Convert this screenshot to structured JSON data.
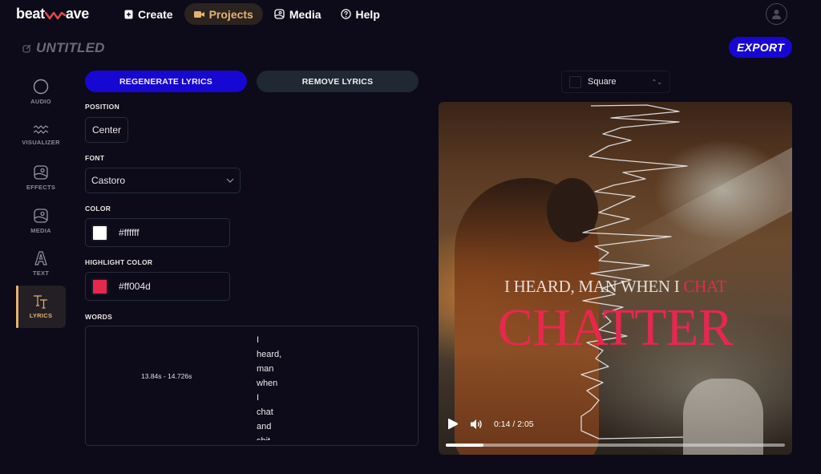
{
  "app": {
    "logo_left": "beat",
    "logo_right": "ave"
  },
  "nav": [
    {
      "label": "Create",
      "icon": "plus-file-icon",
      "active": false
    },
    {
      "label": "Projects",
      "icon": "video-camera-icon",
      "active": true
    },
    {
      "label": "Media",
      "icon": "image-icon",
      "active": false
    },
    {
      "label": "Help",
      "icon": "question-circle-icon",
      "active": false
    }
  ],
  "project": {
    "title": "UNTITLED",
    "export_label": "EXPORT"
  },
  "sidebar": [
    {
      "label": "AUDIO",
      "icon": "circle-icon"
    },
    {
      "label": "VISUALIZER",
      "icon": "wave-icon"
    },
    {
      "label": "EFFECTS",
      "icon": "image-icon"
    },
    {
      "label": "MEDIA",
      "icon": "image-icon"
    },
    {
      "label": "TEXT",
      "icon": "letter-a-icon"
    },
    {
      "label": "LYRICS",
      "icon": "text-size-icon",
      "active": true
    }
  ],
  "lyrics_panel": {
    "regenerate_label": "REGENERATE LYRICS",
    "remove_label": "REMOVE LYRICS",
    "position_label": "POSITION",
    "position_value": "Center",
    "font_label": "FONT",
    "font_value": "Castoro",
    "color_label": "COLOR",
    "color_value": "#ffffff",
    "highlight_label": "HIGHLIGHT COLOR",
    "highlight_value": "#ff004d",
    "words_label": "WORDS",
    "words_time": "13.84s - 14.726s",
    "words": [
      "I",
      "heard,",
      "man",
      "when",
      "I",
      "chat",
      "and",
      "shit"
    ]
  },
  "preview": {
    "aspect_value": "Square",
    "lyric_line_plain": "I HEARD, MAN WHEN I ",
    "lyric_line_highlight": "CHAT",
    "lyric_big": "CHATTER",
    "time_display": "0:14 / 2:05",
    "progress": 0.112
  },
  "colors": {
    "accent_blue": "#1707d2",
    "accent_gold": "#e4b36f",
    "highlight": "#ff004d"
  }
}
